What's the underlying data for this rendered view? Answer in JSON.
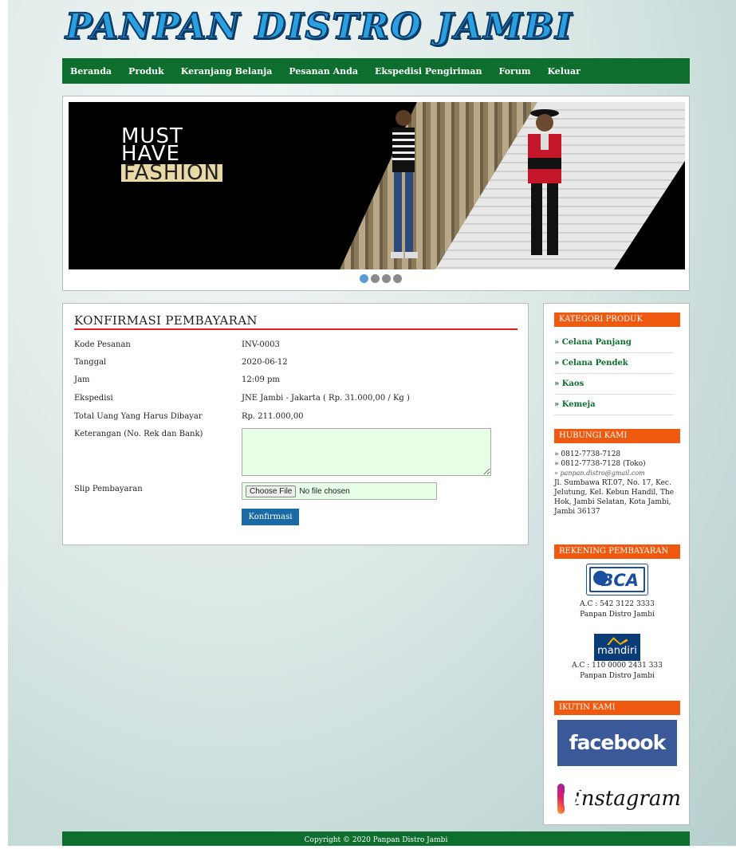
{
  "site": {
    "title": "PANPAN DISTRO JAMBI"
  },
  "nav": {
    "items": [
      {
        "label": "Beranda"
      },
      {
        "label": "Produk"
      },
      {
        "label": "Keranjang Belanja"
      },
      {
        "label": "Pesanan Anda"
      },
      {
        "label": "Ekspedisi Pengiriman"
      },
      {
        "label": "Forum"
      },
      {
        "label": "Keluar"
      }
    ]
  },
  "banner": {
    "line1": "MUST",
    "line2": "HAVE",
    "line3": "FASHION",
    "slides": 4,
    "active_slide": 1
  },
  "form": {
    "title": "KONFIRMASI PEMBAYARAN",
    "fields": [
      {
        "label": "Kode Pesanan",
        "value": "INV-0003"
      },
      {
        "label": "Tanggal",
        "value": "2020-06-12"
      },
      {
        "label": "Jam",
        "value": "12:09 pm"
      },
      {
        "label": "Ekspedisi",
        "value": "JNE Jambi - Jakarta ( Rp. 31.000,00 / Kg )"
      },
      {
        "label": "Total Uang Yang Harus Dibayar",
        "value": "Rp. 211.000,00"
      }
    ],
    "note_label": "Keterangan (No. Rek dan Bank)",
    "slip_label": "Slip Pembayaran",
    "file_button": "Choose File",
    "file_status": "No file chosen",
    "submit_label": "Konfirmasi"
  },
  "sidebar": {
    "category_title": "KATEGORI PRODUK",
    "categories": [
      "» Celana Panjang",
      "» Celana Pendek",
      "» Kaos",
      "» Kemeja"
    ],
    "contact_title": "HUBUNGI KAMI",
    "contact": {
      "phone1": "» 0812-7738-7128",
      "phone2": "» 0812-7738-7128 (Toko)",
      "email": "» panpan.distro@gmail.com",
      "address": "Jl. Sumbawa RT.07, No. 17, Kec. Jelutung, Kel. Kebun Handil, The Hok, Jambi Selatan, Kota Jambi, Jambi 36137"
    },
    "bank_title": "REKENING PEMBAYARAN",
    "banks": [
      {
        "logo": "BCA",
        "account": "A.C : 542 3122 3333",
        "holder": "Panpan Distro Jambi"
      },
      {
        "logo": "mandiri",
        "account": "A.C : 110 0000 2431 333",
        "holder": "Panpan Distro Jambi"
      }
    ],
    "follow_title": "IKUTIN KAMI",
    "facebook": "facebook",
    "instagram": "Instagram"
  },
  "footer": {
    "text": "Copyright © 2020 Panpan Distro Jambi"
  },
  "colors": {
    "nav": "#0d6e2e",
    "sidebar_head": "#ef5a10",
    "rule": "#dd2222",
    "button": "#1a6aa6"
  }
}
